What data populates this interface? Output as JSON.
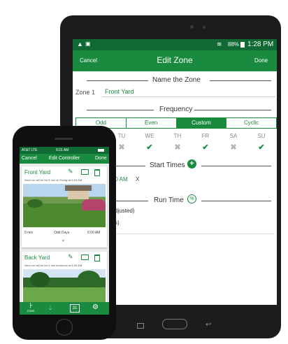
{
  "tablet": {
    "status": {
      "battery": "88%",
      "time": "1:28 PM"
    },
    "appbar": {
      "cancel": "Cancel",
      "title": "Edit Zone",
      "done": "Done"
    },
    "name_section": {
      "title": "Name the Zone",
      "label": "Zone 1",
      "value": "Front Yard"
    },
    "frequency": {
      "title": "Frequency",
      "options": [
        "Odd",
        "Even",
        "Custom",
        "Cyclic"
      ],
      "selected_index": 2,
      "days": [
        "TU",
        "WE",
        "TH",
        "FR",
        "SA",
        "SU"
      ],
      "day_checked": [
        false,
        true,
        false,
        true,
        false,
        true
      ]
    },
    "start_times": {
      "title": "Start Times",
      "time": "00 AM",
      "remove": "X"
    },
    "run_time": {
      "title": "Run Time",
      "line1": "djusted)",
      "line2": "s)"
    }
  },
  "phone": {
    "status": {
      "carrier": "AT&T  LTE",
      "time": "9:21 AM"
    },
    "appbar": {
      "cancel": "Cancel",
      "title": "Edit Controller",
      "done": "Done"
    },
    "zones": [
      {
        "name": "Front Yard",
        "next_run": "Next run will be for 9 min on Friday at 6:24 AM",
        "duration": "9 min",
        "days": "Odd Days",
        "time": "6:00 AM"
      },
      {
        "name": "Back Yard",
        "next_run": "Next run will be for 9 min tomorrow at 6:00 AM"
      }
    ],
    "tabbar": {
      "zone_label": "ZONE",
      "calendar_day": "31"
    }
  },
  "colors": {
    "brand_green": "#1a8a3e",
    "dark_green": "#0f6a33"
  }
}
